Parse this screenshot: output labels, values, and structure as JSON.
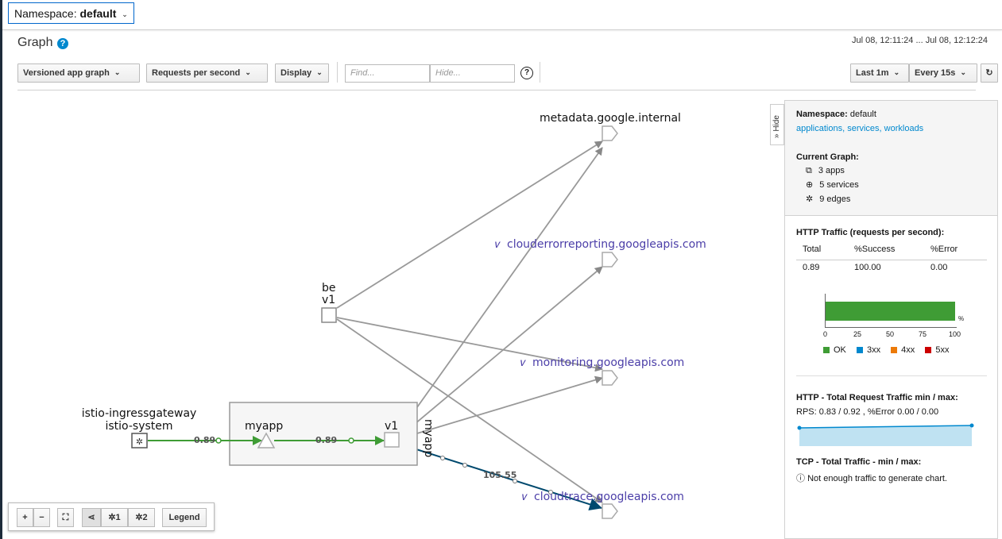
{
  "namespace_select": {
    "label": "Namespace:",
    "value": "default"
  },
  "page": {
    "title": "Graph",
    "time_range": "Jul 08, 12:11:24 ... Jul 08, 12:12:24"
  },
  "toolbar": {
    "graph_type": "Versioned app graph",
    "edge_labels": "Requests per second",
    "display": "Display",
    "find_placeholder": "Find...",
    "hide_placeholder": "Hide...",
    "duration": "Last 1m",
    "refresh": "Every 15s"
  },
  "graph": {
    "nodes": {
      "metadata": "metadata.google.internal",
      "clouderror": "clouderrorreporting.googleapis.com",
      "monitoring": "monitoring.googleapis.com",
      "cloudtrace": "cloudtrace.googleapis.com",
      "be_app": "be",
      "be_version": "v1",
      "ingress_name": "istio-ingressgateway",
      "ingress_ns": "istio-system",
      "myapp_box": "myapp",
      "myapp_version": "v1",
      "myapp_side": "myapp"
    },
    "edges": {
      "ingress_to_myapp": "0.89",
      "myapp_to_v1": "0.89",
      "to_cloudtrace": "105.55"
    }
  },
  "side_tab": {
    "label": "» Hide"
  },
  "summary": {
    "namespace_label": "Namespace:",
    "namespace_value": "default",
    "links": "applications, services, workloads",
    "current_graph": "Current Graph:",
    "apps": "3 apps",
    "services": "5 services",
    "edges": "9 edges",
    "http_traffic_title": "HTTP Traffic (requests per second):",
    "table": {
      "headers": [
        "Total",
        "%Success",
        "%Error"
      ],
      "row": [
        "0.89",
        "100.00",
        "0.00"
      ]
    },
    "bar_ticks": [
      "0",
      "25",
      "50",
      "75",
      "100"
    ],
    "bar_unit": "%",
    "ok_percent": 100,
    "legend": [
      {
        "label": "OK",
        "color": "#3f9c35"
      },
      {
        "label": "3xx",
        "color": "#0088ce"
      },
      {
        "label": "4xx",
        "color": "#ec7a08"
      },
      {
        "label": "5xx",
        "color": "#cc0000"
      }
    ],
    "http_minmax_title": "HTTP - Total Request Traffic min / max:",
    "http_minmax_value": "RPS: 0.83 / 0.92 , %Error 0.00 / 0.00",
    "tcp_title": "TCP - Total Traffic - min / max:",
    "tcp_note": "Not enough traffic to generate chart."
  },
  "bottom_toolbar": {
    "zoom_in": "+",
    "zoom_out": "−",
    "layout1": "1",
    "layout2": "2",
    "legend": "Legend"
  }
}
